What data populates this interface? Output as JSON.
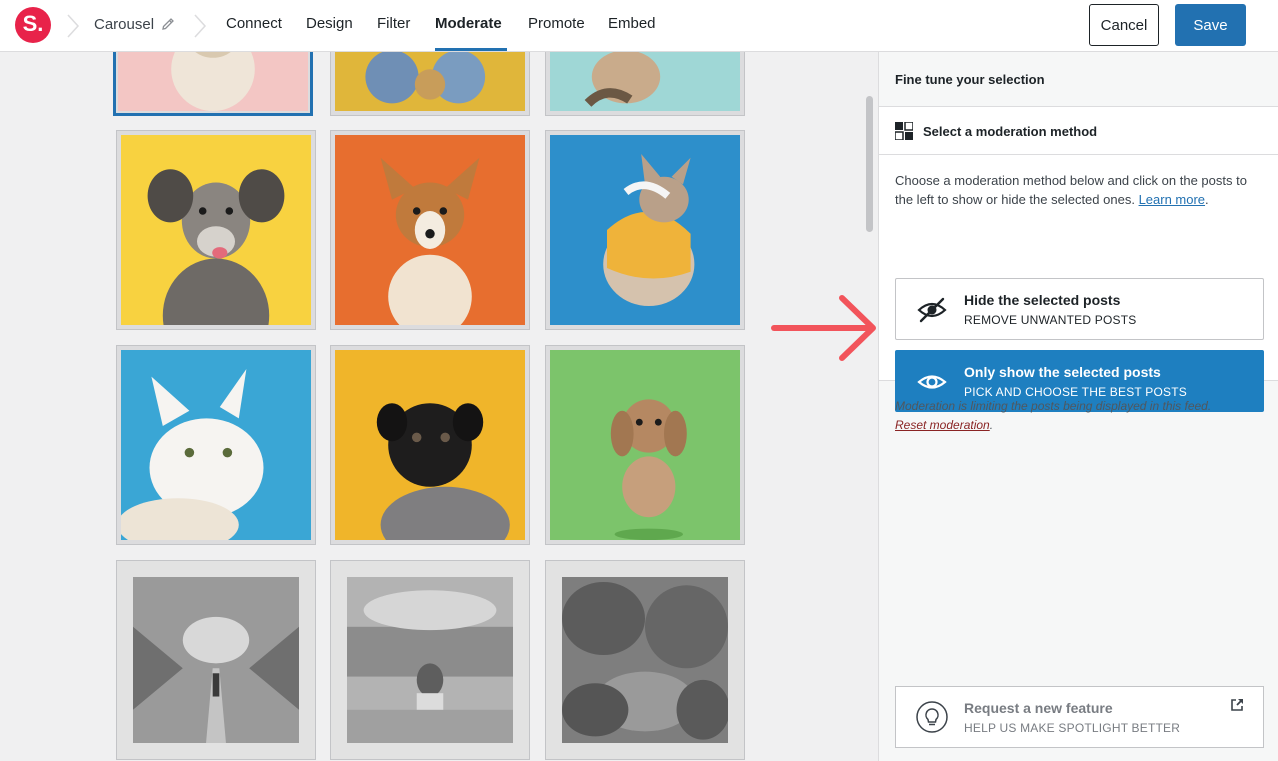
{
  "app": {
    "logo_text": "S."
  },
  "breadcrumb": {
    "title": "Carousel"
  },
  "nav": {
    "items": [
      {
        "label": "Connect"
      },
      {
        "label": "Design"
      },
      {
        "label": "Filter"
      },
      {
        "label": "Moderate",
        "active": true
      },
      {
        "label": "Promote"
      },
      {
        "label": "Embed"
      }
    ]
  },
  "toolbar": {
    "cancel_label": "Cancel",
    "save_label": "Save"
  },
  "panel": {
    "header": "Fine tune your selection",
    "section_title": "Select a moderation method",
    "description": "Choose a moderation method below and click on the posts to the left to show or hide the selected ones.",
    "learn_more": "Learn more",
    "options": [
      {
        "title": "Hide the selected posts",
        "subtitle": "REMOVE UNWANTED POSTS",
        "icon": "eye-slash-icon",
        "active": false
      },
      {
        "title": "Only show the selected posts",
        "subtitle": "PICK AND CHOOSE THE BEST POSTS",
        "icon": "eye-icon",
        "active": true
      }
    ],
    "note": "Moderation is limiting the posts being displayed in this feed.",
    "reset_link": "Reset moderation",
    "feature": {
      "title": "Request a new feature",
      "subtitle": "HELP US MAKE SPOTLIGHT BETTER",
      "icon": "lightbulb-icon"
    }
  },
  "colors": {
    "accent": "#2271b1",
    "active_option": "#1e7fc0",
    "logo": "#e8234a",
    "arrow": "#f2545b"
  }
}
